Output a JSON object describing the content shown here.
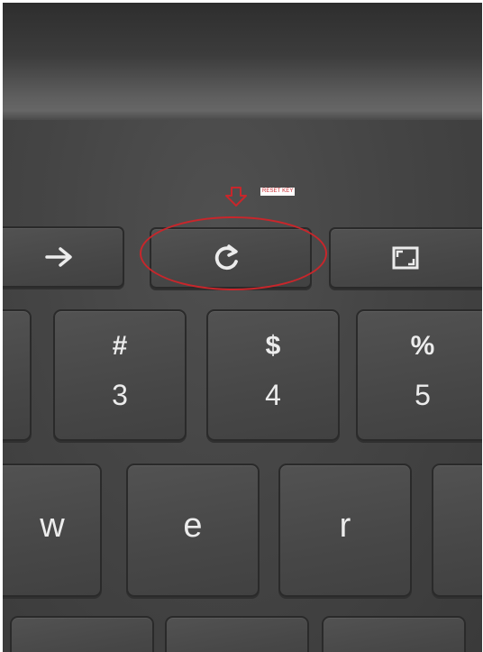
{
  "photo": {
    "subject": "keyboard closeup"
  },
  "annotation": {
    "tag_text": "RESET KEY",
    "color": "#c8262b"
  },
  "function_row": [
    {
      "name": "forward-key",
      "icon": "arrow-right-icon"
    },
    {
      "name": "refresh-key",
      "icon": "refresh-icon"
    },
    {
      "name": "fullscreen-key",
      "icon": "fullscreen-icon"
    }
  ],
  "number_row": [
    {
      "symbol": "#",
      "number": "3"
    },
    {
      "symbol": "$",
      "number": "4"
    },
    {
      "symbol": "%",
      "number": "5"
    }
  ],
  "letter_row": [
    {
      "letter": "w"
    },
    {
      "letter": "e"
    },
    {
      "letter": "r"
    }
  ]
}
